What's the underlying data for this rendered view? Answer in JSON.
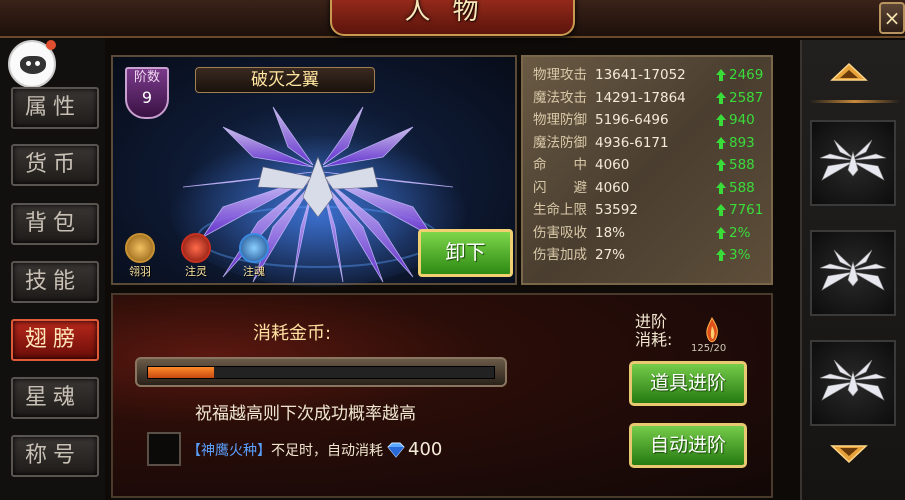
{
  "header": {
    "title": "人物",
    "close_label": "×"
  },
  "sidebar": {
    "tabs": [
      {
        "label": "属性",
        "active": false
      },
      {
        "label": "货币",
        "active": false
      },
      {
        "label": "背包",
        "active": false
      },
      {
        "label": "技能",
        "active": false
      },
      {
        "label": "翅膀",
        "active": true
      },
      {
        "label": "星魂",
        "active": false
      },
      {
        "label": "称号",
        "active": false
      }
    ]
  },
  "wing": {
    "rank_label": "阶数",
    "rank_value": "9",
    "name": "破灭之翼",
    "skills": [
      {
        "label": "翎羽",
        "icon": "feather-icon",
        "color": "#d9a030"
      },
      {
        "label": "注灵",
        "icon": "spirit-icon",
        "color": "#c83020"
      },
      {
        "label": "注魂",
        "icon": "soul-icon",
        "color": "#3a8ae0"
      }
    ],
    "unequip_label": "卸下"
  },
  "stats": [
    {
      "name": "物理攻击",
      "value": "13641-17052",
      "bonus": "2469"
    },
    {
      "name": "魔法攻击",
      "value": "14291-17864",
      "bonus": "2587"
    },
    {
      "name": "物理防御",
      "value": "5196-6496",
      "bonus": "940"
    },
    {
      "name": "魔法防御",
      "value": "4936-6171",
      "bonus": "893"
    },
    {
      "name": "命　　中",
      "value": "4060",
      "bonus": "588"
    },
    {
      "name": "闪　　避",
      "value": "4060",
      "bonus": "588"
    },
    {
      "name": "生命上限",
      "value": "53592",
      "bonus": "7761"
    },
    {
      "name": "伤害吸收",
      "value": "18%",
      "bonus": "2%"
    },
    {
      "name": "伤害加成",
      "value": "27%",
      "bonus": "3%"
    }
  ],
  "advance": {
    "cost_title": "消耗金币:",
    "progress": 0.19,
    "hint": "祝福越高则下次成功概率越高",
    "item_name": "【神鹰火种】",
    "consume_text": "不足时，自动消耗",
    "gem_count": "400",
    "cost_label": "进阶\n消耗:",
    "ember_count": "125/20",
    "item_button": "道具进阶",
    "auto_button": "自动进阶"
  },
  "colors": {
    "accent_green": "#3adc3a",
    "active_tab": "#b8281c",
    "wing_purple": "#8a5ae8"
  }
}
